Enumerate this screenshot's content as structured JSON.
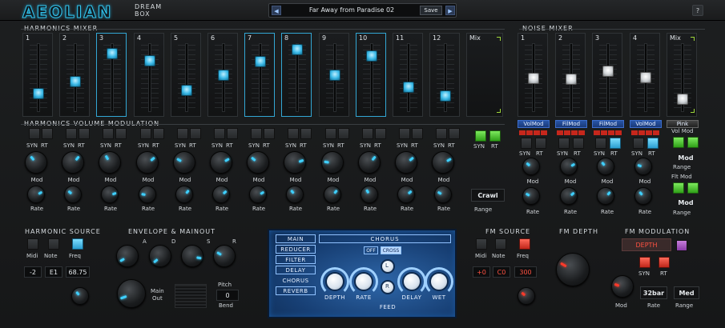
{
  "app": {
    "logo": "AEOLIAN",
    "logo_sub_1": "DREAM",
    "logo_sub_2": "BOX",
    "help_label": "?"
  },
  "preset": {
    "prev": "◀",
    "next": "▶",
    "name": "Far Away from Paradise 02",
    "save_label": "Save"
  },
  "harmonics_mixer": {
    "title": "HARMONICS MIXER",
    "faders": [
      {
        "label": "1",
        "level": 0.25
      },
      {
        "label": "2",
        "level": 0.45
      },
      {
        "label": "3",
        "level": 0.92
      },
      {
        "label": "4",
        "level": 0.8
      },
      {
        "label": "5",
        "level": 0.3
      },
      {
        "label": "6",
        "level": 0.55
      },
      {
        "label": "7",
        "level": 0.78
      },
      {
        "label": "8",
        "level": 0.98
      },
      {
        "label": "9",
        "level": 0.55
      },
      {
        "label": "10",
        "level": 0.88
      },
      {
        "label": "11",
        "level": 0.35
      },
      {
        "label": "12",
        "level": 0.2
      }
    ],
    "mix_label": "Mix"
  },
  "noise_mixer": {
    "title": "NOISE MIXER",
    "faders": [
      {
        "label": "1",
        "level": 0.5
      },
      {
        "label": "2",
        "level": 0.48
      },
      {
        "label": "3",
        "level": 0.62
      },
      {
        "label": "4",
        "level": 0.52
      },
      {
        "label": "Mix",
        "level": 0.15
      }
    ],
    "mod_tabs": [
      "VolMod",
      "FilMod",
      "FilMod",
      "VolMod",
      "Pink"
    ],
    "vol_mod_label": "Vol Mod",
    "flt_mod_label": "Flt Mod",
    "mod_label": "Mod",
    "range_label": "Range",
    "syn": "SYN",
    "rt": "RT",
    "rate": "Rate"
  },
  "hvm": {
    "title": "HARMONICS VOLUME MODULATION",
    "syn": "SYN",
    "rt": "RT",
    "mod": "Mod",
    "rate": "Rate",
    "crawl": "Crawl",
    "range": "Range"
  },
  "harmonic_source": {
    "title": "HARMONIC SOURCE",
    "midi": "Midi",
    "note": "Note",
    "freq": "Freq",
    "v1": "-2",
    "v2": "E1",
    "v3": "68.75"
  },
  "envelope": {
    "title": "ENVELOPE & MAINOUT",
    "a": "A",
    "d": "D",
    "s": "S",
    "r": "R",
    "main_out_1": "Main",
    "main_out_2": "Out",
    "pitch": "Pitch",
    "pitch_val": "0",
    "bend": "Bend"
  },
  "fx": {
    "menu": [
      "MAIN",
      "REDUCER",
      "FILTER",
      "DELAY",
      "CHORUS",
      "REVERB"
    ],
    "title": "CHORUS",
    "off": "OFF",
    "cross": "CROSS",
    "l": "L",
    "r": "R",
    "depth": "DEPTH",
    "rate": "RATE",
    "feed": "FEED",
    "delay": "DELAY",
    "wet": "WET"
  },
  "fm_source": {
    "title": "FM SOURCE",
    "midi": "Midi",
    "note": "Note",
    "freq": "Freq",
    "v1": "+0",
    "v2": "C0",
    "v3": "300"
  },
  "fm_depth": {
    "title": "FM DEPTH"
  },
  "fm_mod": {
    "title": "FM MODULATION",
    "depth_btn": "DEPTH",
    "syn": "SYN",
    "rt": "RT",
    "mod": "Mod",
    "rate_val": "32bar",
    "rate": "Rate",
    "range_val": "Med",
    "range": "Range"
  },
  "noise_mods": {
    "mod_val_1": "Mod",
    "range_1": "Range",
    "mod_val_2": "Mod",
    "range_2": "Range"
  }
}
